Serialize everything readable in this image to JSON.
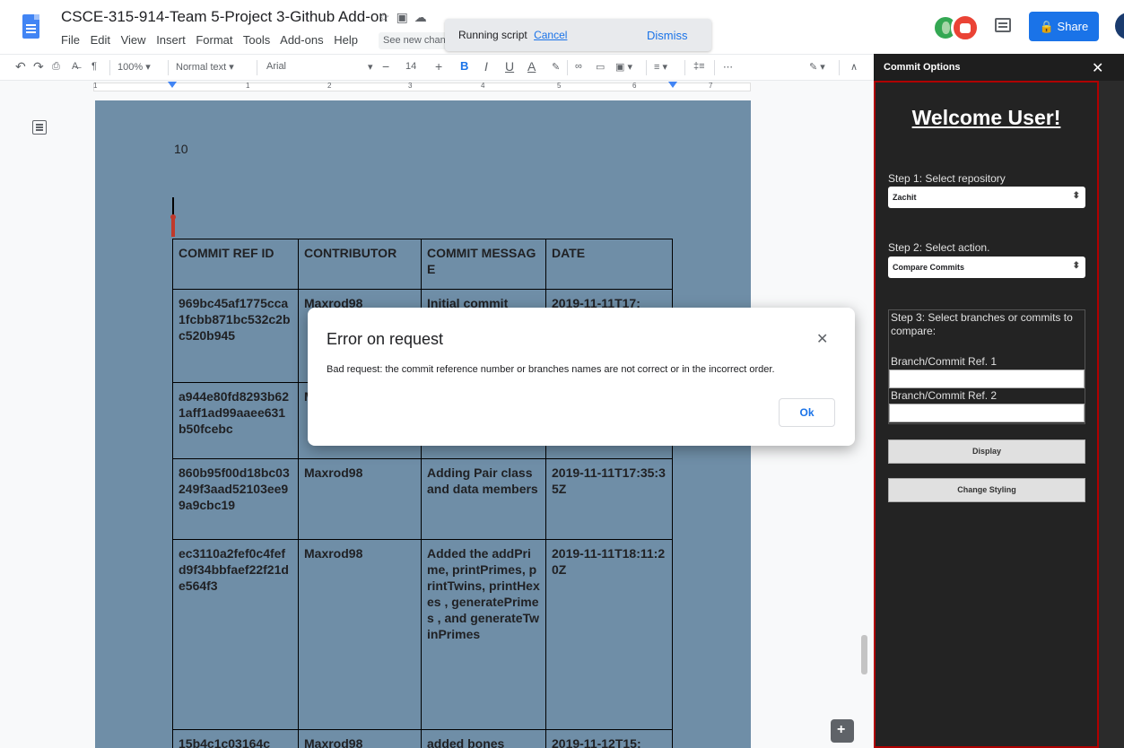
{
  "document": {
    "title": "CSCE-315-914-Team 5-Project 3-Github Add-on",
    "menu": [
      "File",
      "Edit",
      "View",
      "Insert",
      "Format",
      "Tools",
      "Add-ons",
      "Help"
    ],
    "see_changes": "See new changes",
    "share_label": "Share",
    "page_number": "10"
  },
  "script_toast": {
    "message": "Running script",
    "cancel_label": "Cancel",
    "dismiss_label": "Dismiss"
  },
  "toolbar": {
    "zoom": "100%",
    "style": "Normal text",
    "font": "Arial",
    "font_size": "14",
    "bold": "B",
    "italic": "I",
    "underline": "U",
    "text_color": "A",
    "more": "⋯"
  },
  "ruler": {
    "numbers": [
      "1",
      "1",
      "2",
      "3",
      "4",
      "5",
      "6",
      "7"
    ]
  },
  "table": {
    "headers": [
      "COMMIT REF ID",
      "CONTRIBUTOR",
      "COMMIT MESSAGE",
      "DATE"
    ],
    "rows": [
      [
        "969bc45af1775cca1fcbb871bc532c2bc520b945",
        "Maxrod98",
        "Initial commit",
        "2019-11-11T17:"
      ],
      [
        "a944e80fd8293b621aff1ad99aaee631b50fcebc",
        "M",
        "",
        ""
      ],
      [
        "860b95f00d18bc03249f3aad52103ee99a9cbc19",
        "Maxrod98",
        "Adding Pair class and data members",
        "2019-11-11T17:35:35Z"
      ],
      [
        "ec3110a2fef0c4fefd9f34bbfaef22f21de564f3",
        "Maxrod98",
        "Added the addPrime, printPrimes, printTwins, printHexes , generatePrimes , and generateTwinPrimes",
        "2019-11-11T18:11:20Z"
      ],
      [
        "15b4c1c03164c",
        "Maxrod98",
        "added bones",
        "2019-11-12T15:"
      ]
    ]
  },
  "sidebar": {
    "header_title": "Commit Options",
    "welcome": "Welcome User!",
    "step1_label": "Step 1: Select repository",
    "repository": "Zachit",
    "step2_label": "Step 2: Select action.",
    "action": "Compare Commits",
    "step3_label": "Step 3: Select branches or commits to compare:",
    "ref1_label": "Branch/Commit Ref. 1",
    "ref2_label": "Branch/Commit Ref. 2",
    "display_label": "Display",
    "styling_label": "Change Styling"
  },
  "modal": {
    "title": "Error on request",
    "message": "Bad request: the commit reference number or branches names are not correct or in the incorrect order.",
    "ok_label": "Ok"
  },
  "colors": {
    "page_background": "#6f8ea7",
    "share_button": "#1a73e8",
    "sidebar_panel": "#232323",
    "sidebar_border": "#b00000"
  }
}
